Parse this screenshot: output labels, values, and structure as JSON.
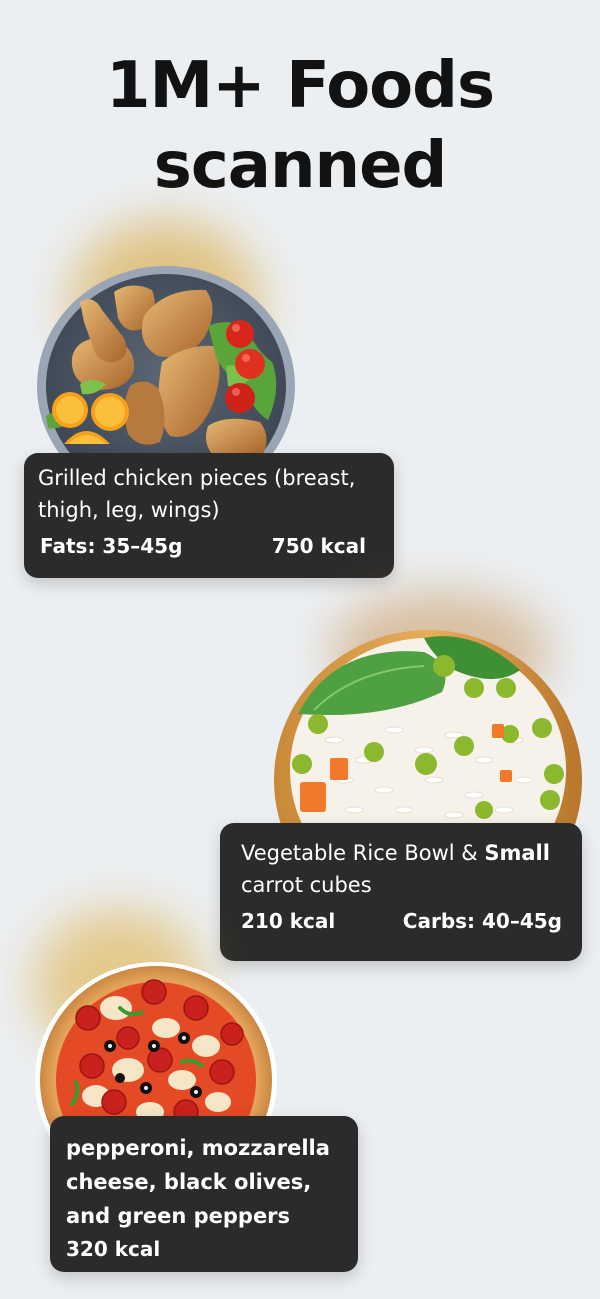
{
  "title": {
    "line1": "1M+ Foods",
    "line2": "scanned"
  },
  "cards": [
    {
      "description": "Grilled chicken pieces (breast, thigh, leg, wings)",
      "left_stat": "Fats: 35–45g",
      "right_stat": "750 kcal",
      "image": "grilled-chicken-plate"
    },
    {
      "description_regular": "Vegetable Rice Bowl & ",
      "description_bold": "Small",
      "description_line2": "carrot cubes",
      "left_stat": "210 kcal",
      "right_stat": "Carbs: 40–45g",
      "image": "vegetable-rice-bowl"
    },
    {
      "description": "pepperoni, mozzarella cheese, black olives, and green peppers",
      "kcal": "320 kcal",
      "image": "pepperoni-pizza"
    }
  ],
  "colors": {
    "background": "#eceff2",
    "card": "#2b2b2b",
    "card_text": "#ffffff",
    "title": "#121212"
  }
}
